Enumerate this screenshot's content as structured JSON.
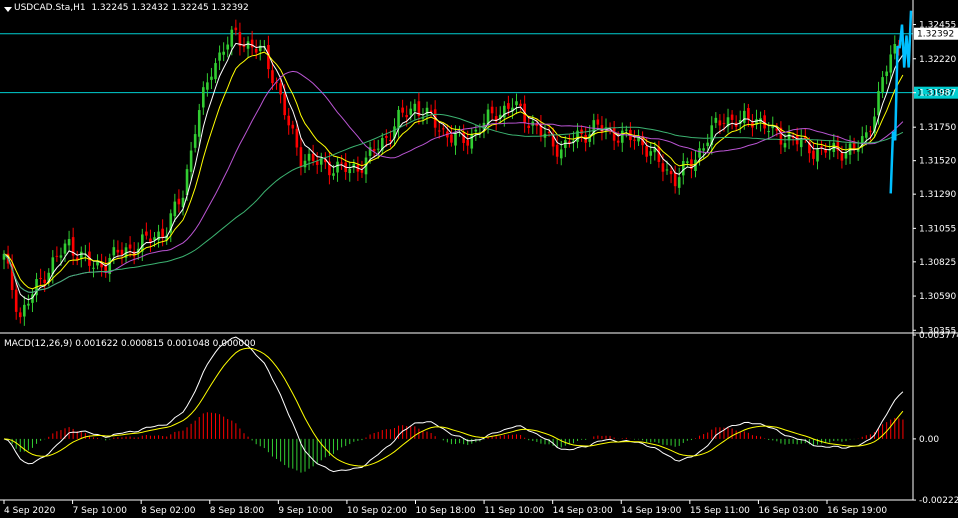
{
  "header": {
    "title": "USDCAD.Sta,H1",
    "ohlc": "1.32245 1.32432 1.32245 1.32392",
    "macd_label": "MACD(12,26,9) 0.001622 0.000815 0.001048 0.000000"
  },
  "price_badges": {
    "bid": "1.32392",
    "hline": "1.31987"
  },
  "colors": {
    "background": "#000000",
    "bull": "#32CD32",
    "bear": "#FF0000",
    "hline": "#00CED1",
    "forecast": "#00BFFF",
    "macd_line": "#FFFFFF",
    "signal_line": "#FFFF00",
    "ma_fast": "#FFFFFF",
    "ma_mid": "#FFFF00",
    "ma_slow": "#BA55D3",
    "ma_long": "#3CB371"
  },
  "chart_data": [
    {
      "type": "candlestick",
      "symbol": "USDCAD.Sta",
      "timeframe": "H1",
      "ylim": [
        1.3035,
        1.325
      ],
      "y_ticks": [
        "1.32455",
        "1.32220",
        "1.31987",
        "1.31750",
        "1.31520",
        "1.31290",
        "1.31055",
        "1.30825",
        "1.30590",
        "1.30355"
      ],
      "x_ticks": [
        "4 Sep 2020",
        "7 Sep 10:00",
        "8 Sep 02:00",
        "8 Sep 18:00",
        "9 Sep 10:00",
        "10 Sep 02:00",
        "10 Sep 18:00",
        "11 Sep 10:00",
        "14 Sep 03:00",
        "14 Sep 19:00",
        "15 Sep 11:00",
        "16 Sep 03:00",
        "16 Sep 19:00"
      ],
      "horizontal_lines": [
        1.32392,
        1.31987
      ],
      "close_path": [
        [
          0,
          1.3085
        ],
        [
          4,
          1.3045
        ],
        [
          10,
          1.3075
        ],
        [
          16,
          1.3095
        ],
        [
          22,
          1.3078
        ],
        [
          28,
          1.3088
        ],
        [
          34,
          1.3095
        ],
        [
          40,
          1.3105
        ],
        [
          44,
          1.313
        ],
        [
          47,
          1.3175
        ],
        [
          51,
          1.3215
        ],
        [
          54,
          1.323
        ],
        [
          57,
          1.3238
        ],
        [
          60,
          1.3232
        ],
        [
          64,
          1.3225
        ],
        [
          67,
          1.3205
        ],
        [
          70,
          1.3175
        ],
        [
          73,
          1.3155
        ],
        [
          77,
          1.315
        ],
        [
          81,
          1.3148
        ],
        [
          85,
          1.3145
        ],
        [
          89,
          1.3152
        ],
        [
          93,
          1.3165
        ],
        [
          97,
          1.318
        ],
        [
          101,
          1.319
        ],
        [
          105,
          1.318
        ],
        [
          109,
          1.317
        ],
        [
          113,
          1.3165
        ],
        [
          117,
          1.3175
        ],
        [
          121,
          1.3185
        ],
        [
          125,
          1.319
        ],
        [
          129,
          1.318
        ],
        [
          133,
          1.3168
        ],
        [
          137,
          1.316
        ],
        [
          141,
          1.3168
        ],
        [
          145,
          1.3175
        ],
        [
          149,
          1.3172
        ],
        [
          153,
          1.3168
        ],
        [
          157,
          1.3165
        ],
        [
          161,
          1.315
        ],
        [
          165,
          1.314
        ],
        [
          169,
          1.315
        ],
        [
          173,
          1.3168
        ],
        [
          177,
          1.3182
        ],
        [
          181,
          1.3178
        ],
        [
          185,
          1.3182
        ],
        [
          189,
          1.317
        ],
        [
          193,
          1.3168
        ],
        [
          197,
          1.3162
        ],
        [
          201,
          1.3158
        ],
        [
          205,
          1.316
        ],
        [
          209,
          1.3158
        ],
        [
          212,
          1.317
        ],
        [
          215,
          1.3195
        ],
        [
          218,
          1.3225
        ],
        [
          221,
          1.3239
        ]
      ],
      "forecast_path": [
        [
          1.31295
        ],
        [
          1.3172
        ],
        [
          1.3166
        ],
        [
          1.323
        ],
        [
          1.323
        ],
        [
          1.32455
        ],
        [
          1.3216
        ],
        [
          1.3238
        ],
        [
          1.3216
        ],
        [
          1.3255
        ]
      ]
    },
    {
      "type": "macd",
      "name": "MACD(12,26,9)",
      "values": {
        "macd": 0.001622,
        "signal": 0.000815,
        "histogram": 0.001048,
        "zero": 0.0
      },
      "ylim": [
        -0.00222,
        0.003774
      ],
      "y_ticks": [
        "0.003774",
        "0.00",
        "-0.002222"
      ]
    }
  ]
}
